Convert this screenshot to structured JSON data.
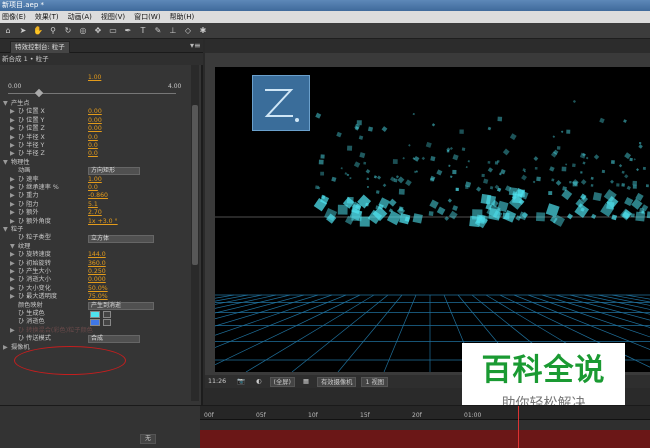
{
  "window": {
    "title": "新项目.aep *"
  },
  "menu": [
    "图像(E)",
    "效果(T)",
    "动画(A)",
    "视图(V)",
    "窗口(W)",
    "帮助(H)"
  ],
  "effects_panel": {
    "tab_label": "特效控制台: 粒子",
    "subtitle": "新合成 1 • 粒子",
    "top_value": "1.00",
    "slider_min": "0.00",
    "slider_max": "4.00",
    "rows": [
      {
        "indent": 1,
        "twirl": "▼",
        "label": "产生点"
      },
      {
        "indent": 2,
        "twirl": "▶",
        "label": "ひ 位置 X",
        "value": "0.00"
      },
      {
        "indent": 2,
        "twirl": "▶",
        "label": "ひ 位置 Y",
        "value": "0.00"
      },
      {
        "indent": 2,
        "twirl": "▶",
        "label": "ひ 位置 Z",
        "value": "0.00"
      },
      {
        "indent": 2,
        "twirl": "▶",
        "label": "ひ 半径 X",
        "value": "0.0"
      },
      {
        "indent": 2,
        "twirl": "▶",
        "label": "ひ 半径 Y",
        "value": "0.0"
      },
      {
        "indent": 2,
        "twirl": "▶",
        "label": "ひ 半径 Z",
        "value": "0.0"
      },
      {
        "indent": 1,
        "twirl": "▼",
        "label": "物理性"
      },
      {
        "indent": 2,
        "twirl": "",
        "label": "动画",
        "dropdown": "方向矩形"
      },
      {
        "indent": 2,
        "twirl": "▶",
        "label": "ひ 速率",
        "value": "1.00"
      },
      {
        "indent": 2,
        "twirl": "▶",
        "label": "ひ 继承速率 %",
        "value": "0.0"
      },
      {
        "indent": 2,
        "twirl": "▶",
        "label": "ひ 重力",
        "value": "-0.860"
      },
      {
        "indent": 2,
        "twirl": "▶",
        "label": "ひ 阻力",
        "value": "5.1"
      },
      {
        "indent": 2,
        "twirl": "▶",
        "label": "ひ 额外",
        "value": "2.70"
      },
      {
        "indent": 2,
        "twirl": "▶",
        "label": "ひ 额外角度",
        "value": "1x +3.0 °"
      },
      {
        "indent": 1,
        "twirl": "▼",
        "label": "粒子"
      },
      {
        "indent": 2,
        "twirl": "",
        "label": "ひ 粒子类型",
        "dropdown": "立方体",
        "wide": true
      },
      {
        "indent": 2,
        "twirl": "▼",
        "label": "纹理"
      },
      {
        "indent": 2,
        "twirl": "▶",
        "label": "ひ 旋转速度",
        "value": "144.0"
      },
      {
        "indent": 2,
        "twirl": "▶",
        "label": "ひ 初始旋转",
        "value": "360.0"
      },
      {
        "indent": 2,
        "twirl": "▶",
        "label": "ひ 产生大小",
        "value": "0.250"
      },
      {
        "indent": 2,
        "twirl": "▶",
        "label": "ひ 消逝大小",
        "value": "0.000"
      },
      {
        "indent": 2,
        "twirl": "▶",
        "label": "ひ 大小变化",
        "value": "50.0%"
      },
      {
        "indent": 2,
        "twirl": "▶",
        "label": "ひ 最大透明度",
        "value": "75.0%"
      },
      {
        "indent": 2,
        "twirl": "",
        "label": "颜色映射",
        "dropdown": "产生到消逝",
        "wide": true
      },
      {
        "indent": 2,
        "twirl": "",
        "label": "ひ 生成色",
        "swatch": "#4fe3f0"
      },
      {
        "indent": 2,
        "twirl": "",
        "label": "ひ 消逝色",
        "swatch": "#3f77e6"
      },
      {
        "indent": 2,
        "twirl": "▶",
        "label": "ひ 转换混合(彩色)粒子颜色",
        "faded": true
      },
      {
        "indent": 2,
        "twirl": "",
        "label": "ひ 传送模式",
        "dropdown": "合成"
      },
      {
        "indent": 1,
        "twirl": "▶",
        "label": "摄像机"
      }
    ]
  },
  "viewer": {
    "zoom": "11:26",
    "resolution": "(全屏)",
    "camera": "有效摄像机",
    "views": "1 视图"
  },
  "watermark": {
    "title": "百科全说",
    "subtitle": "助你轻松解决"
  },
  "timeline": {
    "ticks": [
      "00f",
      "05f",
      "10f",
      "15f",
      "20f",
      "01:00"
    ],
    "mode": "无"
  },
  "colors": {
    "particle": "#4fe3f0",
    "grid": "#1f6f9a",
    "highlight": "#c41e1e"
  }
}
